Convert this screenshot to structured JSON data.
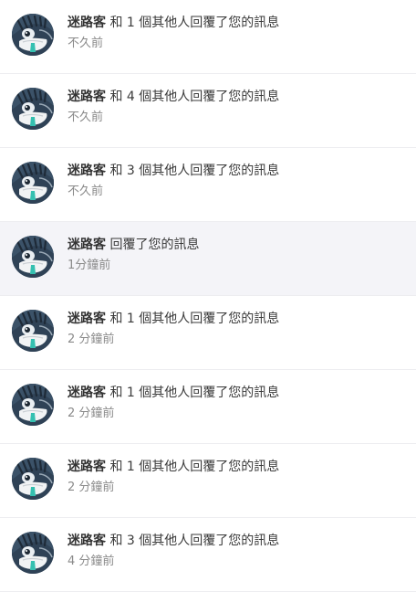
{
  "notifications": [
    {
      "name": "迷路客",
      "message": " 和 1 個其他人回覆了您的訊息",
      "time": "不久前",
      "highlighted": false
    },
    {
      "name": "迷路客",
      "message": " 和 4 個其他人回覆了您的訊息",
      "time": "不久前",
      "highlighted": false
    },
    {
      "name": "迷路客",
      "message": " 和 3 個其他人回覆了您的訊息",
      "time": "不久前",
      "highlighted": false
    },
    {
      "name": "迷路客",
      "message": " 回覆了您的訊息",
      "time": "1分鐘前",
      "highlighted": true
    },
    {
      "name": "迷路客",
      "message": " 和 1 個其他人回覆了您的訊息",
      "time": "2 分鐘前",
      "highlighted": false
    },
    {
      "name": "迷路客",
      "message": " 和 1 個其他人回覆了您的訊息",
      "time": "2 分鐘前",
      "highlighted": false
    },
    {
      "name": "迷路客",
      "message": " 和 1 個其他人回覆了您的訊息",
      "time": "2 分鐘前",
      "highlighted": false
    },
    {
      "name": "迷路客",
      "message": " 和 3 個其他人回覆了您的訊息",
      "time": "4 分鐘前",
      "highlighted": false
    }
  ],
  "colors": {
    "highlight_bg": "#f4f4f8",
    "divider": "#ededf0",
    "name_text": "#333333",
    "time_text": "#8a8a8a"
  },
  "icons": {
    "avatar": "user-avatar-icon"
  }
}
